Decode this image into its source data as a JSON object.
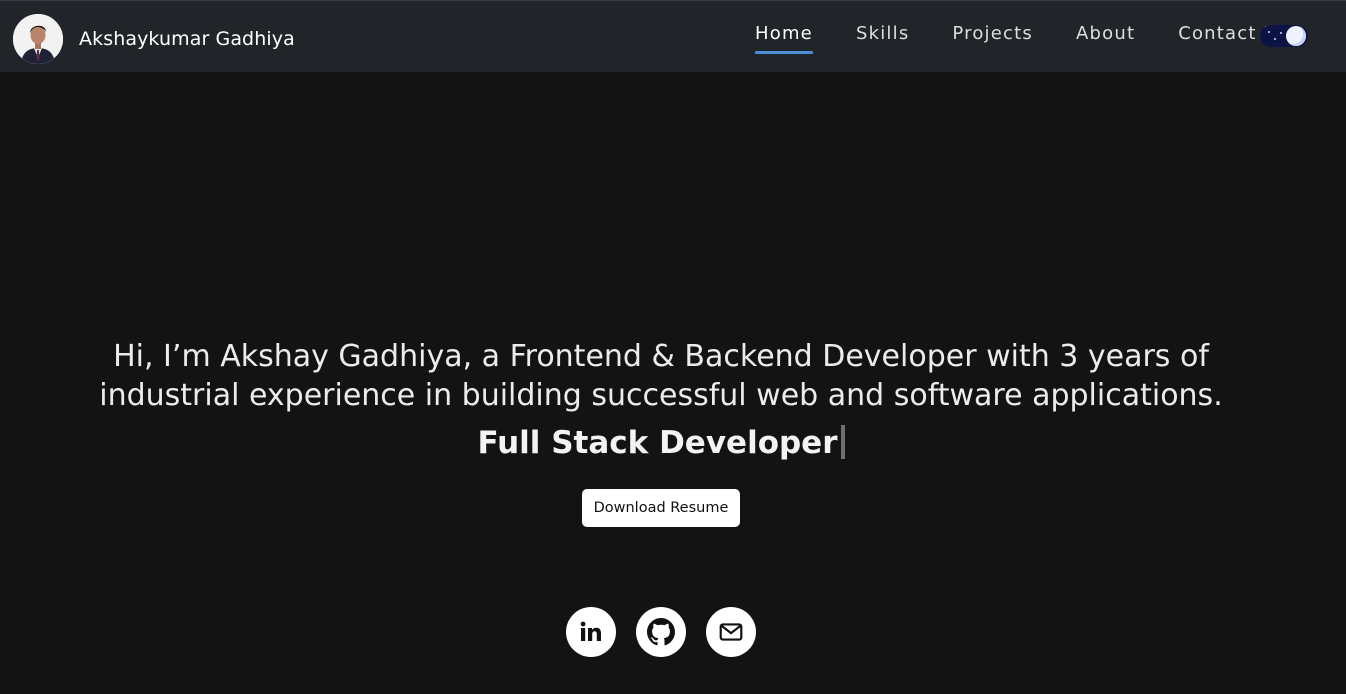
{
  "header": {
    "brand_name": "Akshaykumar Gadhiya",
    "avatar_icon": "profile-photo",
    "nav": [
      {
        "label": "Home",
        "active": true
      },
      {
        "label": "Skills",
        "active": false
      },
      {
        "label": "Projects",
        "active": false
      },
      {
        "label": "About",
        "active": false
      },
      {
        "label": "Contact Me",
        "active": false
      }
    ],
    "theme_toggle": {
      "state": "dark",
      "icon": "moon-icon"
    }
  },
  "hero": {
    "intro": "Hi, I’m Akshay Gadhiya, a Frontend & Backend Developer with 3 years of industrial experience in building successful web and software applications.",
    "role": "Full Stack Developer",
    "resume_button": "Download Resume"
  },
  "socials": [
    {
      "icon": "linkedin-icon"
    },
    {
      "icon": "github-icon"
    },
    {
      "icon": "email-icon"
    }
  ],
  "colors": {
    "background": "#131313",
    "navbar": "#212529",
    "accent": "#4a8fd6",
    "toggle_bg": "#0c1445"
  }
}
